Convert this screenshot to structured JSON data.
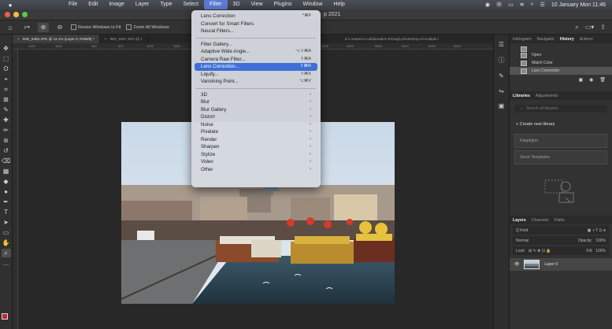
{
  "menubar": {
    "app_menus": [
      "File",
      "Edit",
      "Image",
      "Layer",
      "Type",
      "Select",
      "Filter",
      "3D",
      "View",
      "Plugins",
      "Window",
      "Help"
    ],
    "active_menu": "Filter",
    "clock": "10 January Mon  11:46"
  },
  "window": {
    "title_fragment": "p 2021"
  },
  "options_bar": {
    "resize_windows_label": "Resize Windows to Fit",
    "zoom_all_label": "Zoom All Windows"
  },
  "doc_tabs": [
    {
      "label": "IMG_6482.JPG @ 12.1% (Layer 0, RGB/8) *"
    },
    {
      "label": "IMG_6457.JPG @ 1"
    }
  ],
  "doc_tab_long": "d-i-created-a-collaboration-through-photoshop-of-multiple-i",
  "ruler_ticks": [
    "1000",
    "1500",
    "500",
    "500",
    "1000",
    "1500",
    "4000",
    "4500",
    "5000",
    "5500",
    "6000",
    "6500"
  ],
  "filter_menu": {
    "top_items": [
      {
        "label": "Lens Correction",
        "shortcut": "^⌘F"
      },
      {
        "label": "Convert for Smart Filters",
        "shortcut": ""
      },
      {
        "label": "Neural Filters...",
        "shortcut": ""
      }
    ],
    "filter_items": [
      {
        "label": "Filter Gallery...",
        "shortcut": ""
      },
      {
        "label": "Adaptive Wide Angle...",
        "shortcut": "⌥⇧⌘A"
      },
      {
        "label": "Camera Raw Filter...",
        "shortcut": "⇧⌘A"
      },
      {
        "label": "Lens Correction...",
        "shortcut": "⇧⌘R",
        "highlighted": true
      },
      {
        "label": "Liquify...",
        "shortcut": "⇧⌘X"
      },
      {
        "label": "Vanishing Point...",
        "shortcut": "⌥⌘V"
      }
    ],
    "submenus": [
      "3D",
      "Blur",
      "Blur Gallery",
      "Distort",
      "Noise",
      "Pixelate",
      "Render",
      "Sharpen",
      "Stylize",
      "Video",
      "Other"
    ]
  },
  "panels": {
    "top_tabs": [
      "Histogram",
      "Navigator",
      "History",
      "Actions"
    ],
    "active_top_tab": "History",
    "history_items": [
      {
        "label": "Open"
      },
      {
        "label": "Match Color"
      },
      {
        "label": "Lens Correction"
      }
    ],
    "library_tabs": [
      "Libraries",
      "Adjustments"
    ],
    "library_search_placeholder": "Search all libraries",
    "create_library_label": "+ Create new library",
    "library_items": [
      "Kitaplığım",
      "Stock Templates"
    ],
    "layers_tabs": [
      "Layers",
      "Channels",
      "Paths"
    ],
    "layers_kind": "Q Kind",
    "blend_mode": "Normal",
    "opacity_label": "Opacity:",
    "opacity_value": "100%",
    "lock_label": "Lock:",
    "fill_label": "Fill:",
    "fill_value": "100%",
    "layer_name": "Layer 0"
  },
  "colors": {
    "foreground": "#c4262e",
    "background": "#ffffff",
    "menu_highlight": "#3e6fd7"
  }
}
